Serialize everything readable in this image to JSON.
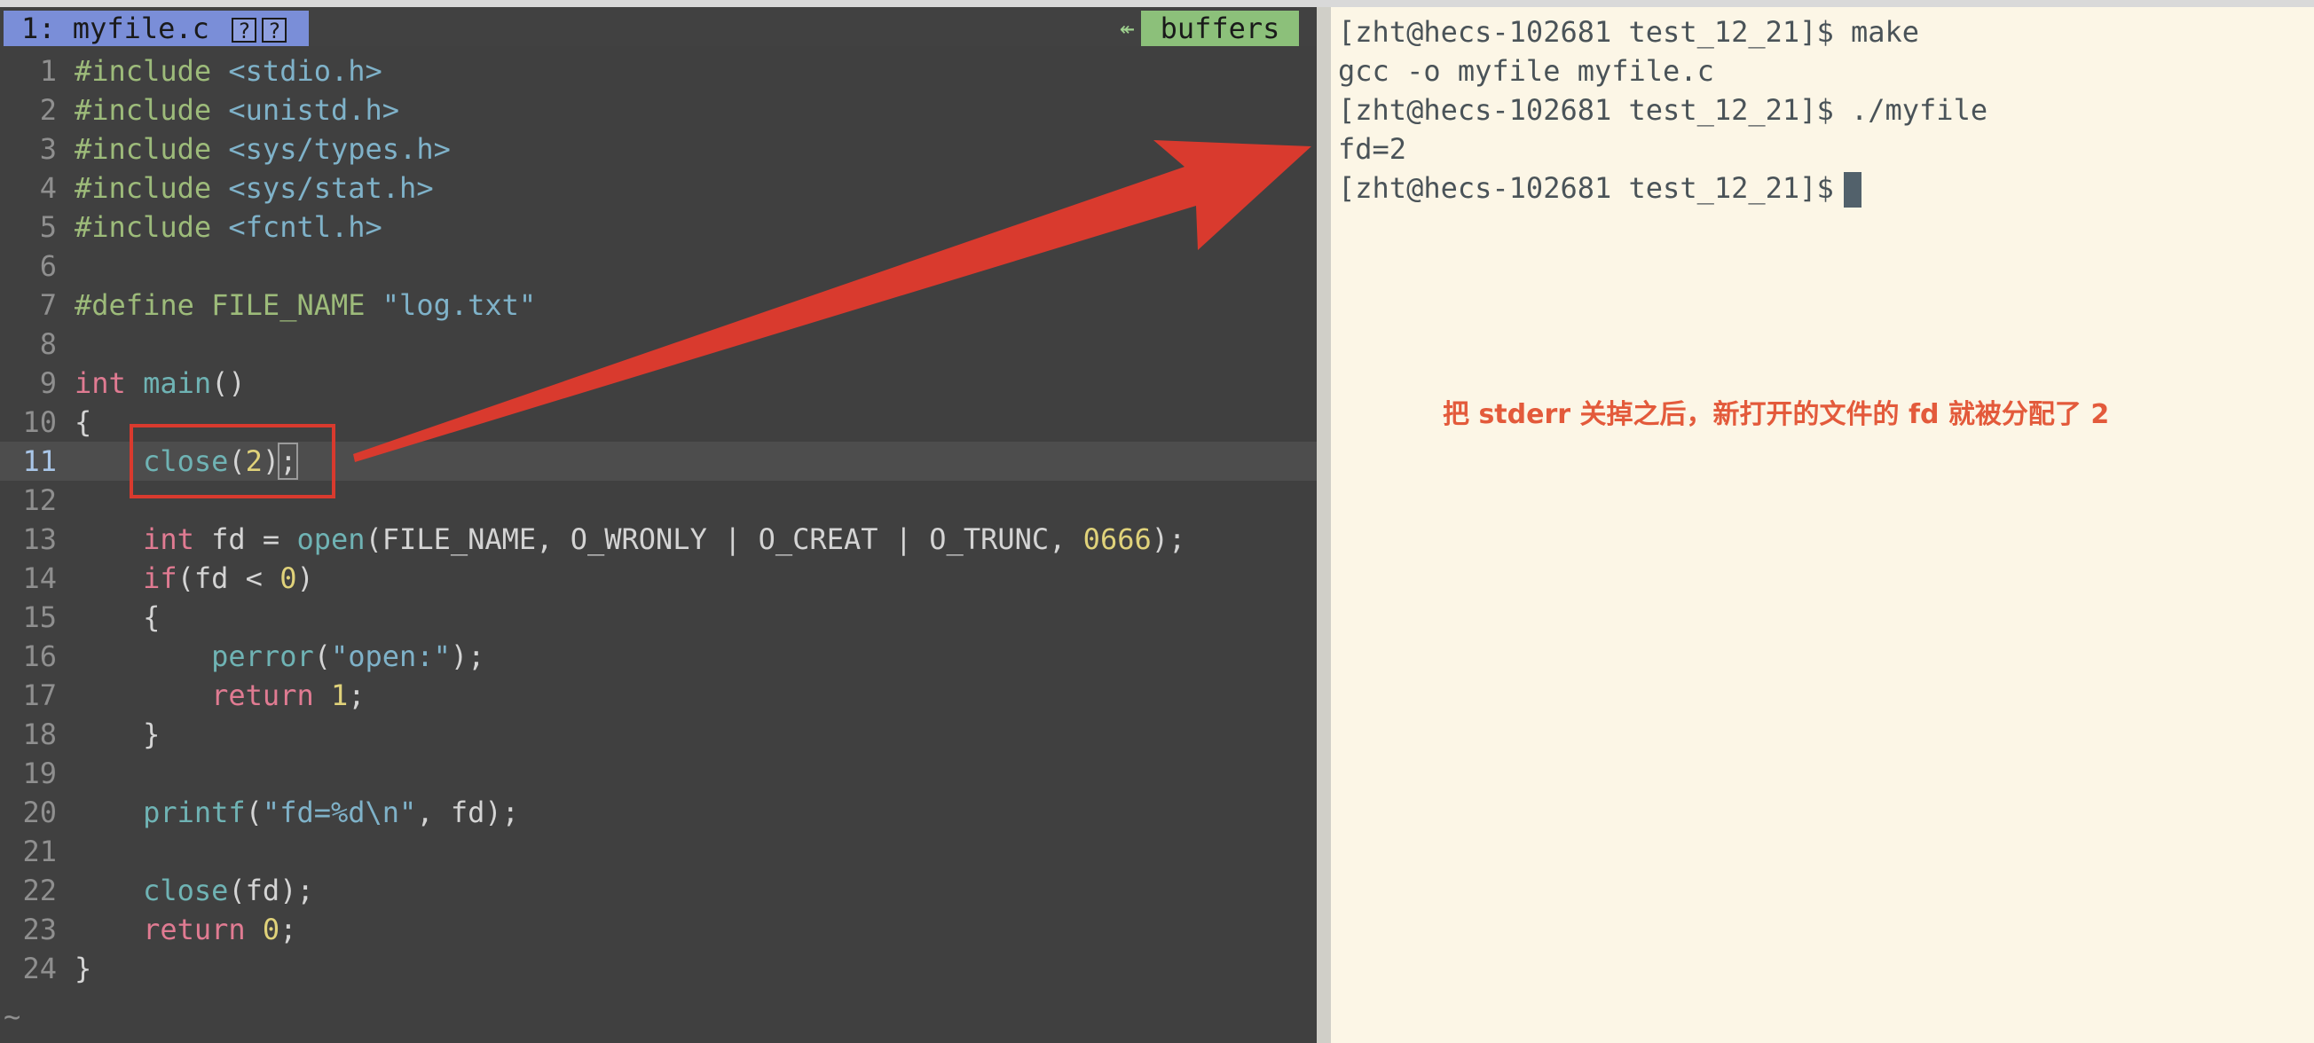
{
  "editor": {
    "tab_label": "1: myfile.c",
    "tab_flag_1": "?",
    "tab_flag_2": "?",
    "buffers_arrow": "↞",
    "buffers_label": "buffers",
    "tilde": "~",
    "line_numbers": [
      "1",
      "2",
      "3",
      "4",
      "5",
      "6",
      "7",
      "8",
      "9",
      "10",
      "11",
      "12",
      "13",
      "14",
      "15",
      "16",
      "17",
      "18",
      "19",
      "20",
      "21",
      "22",
      "23",
      "24"
    ]
  },
  "code": {
    "l1": {
      "a": "#include ",
      "b": "<stdio.h>"
    },
    "l2": {
      "a": "#include ",
      "b": "<unistd.h>"
    },
    "l3": {
      "a": "#include ",
      "b": "<sys/types.h>"
    },
    "l4": {
      "a": "#include ",
      "b": "<sys/stat.h>"
    },
    "l5": {
      "a": "#include ",
      "b": "<fcntl.h>"
    },
    "l7": {
      "a": "#define FILE_NAME ",
      "b": "\"log.txt\""
    },
    "l9": {
      "kw": "int",
      "sp": " ",
      "fn": "main",
      "rest": "()"
    },
    "l10": {
      "t": "{"
    },
    "l11": {
      "indent": "    ",
      "fn": "close",
      "p1": "(",
      "num": "2",
      "p2": ")",
      "semi": ";"
    },
    "l13": {
      "indent": "    ",
      "kw": "int",
      "t1": " fd = ",
      "fn": "open",
      "t2": "(FILE_NAME, O_WRONLY | O_CREAT | O_TRUNC, ",
      "num": "0666",
      "t3": ");"
    },
    "l14": {
      "indent": "    ",
      "kw": "if",
      "t1": "(fd < ",
      "num": "0",
      "t2": ")"
    },
    "l15": {
      "t": "    {"
    },
    "l16": {
      "indent": "        ",
      "fn": "perror",
      "p1": "(",
      "str": "\"open:\"",
      "p2": ");"
    },
    "l17": {
      "indent": "        ",
      "kw": "return",
      "sp": " ",
      "num": "1",
      "semi": ";"
    },
    "l18": {
      "t": "    }"
    },
    "l20": {
      "indent": "    ",
      "fn": "printf",
      "p1": "(",
      "str": "\"fd=%d\\n\"",
      "p2": ", fd);"
    },
    "l22": {
      "indent": "    ",
      "fn": "close",
      "rest": "(fd);"
    },
    "l23": {
      "indent": "    ",
      "kw": "return",
      "sp": " ",
      "num": "0",
      "semi": ";"
    },
    "l24": {
      "t": "}"
    }
  },
  "terminal": {
    "lines": [
      "[zht@hecs-102681 test_12_21]$ make",
      "gcc -o myfile myfile.c",
      "[zht@hecs-102681 test_12_21]$ ./myfile",
      "fd=2",
      "[zht@hecs-102681 test_12_21]$ "
    ],
    "note": "把 stderr 关掉之后，新打开的文件的 fd 就被分配了 2"
  },
  "colors": {
    "annotation_red": "#d93a2e",
    "note_orange": "#e35a3b",
    "editor_bg": "#404040",
    "terminal_bg": "#fcf6e6"
  }
}
